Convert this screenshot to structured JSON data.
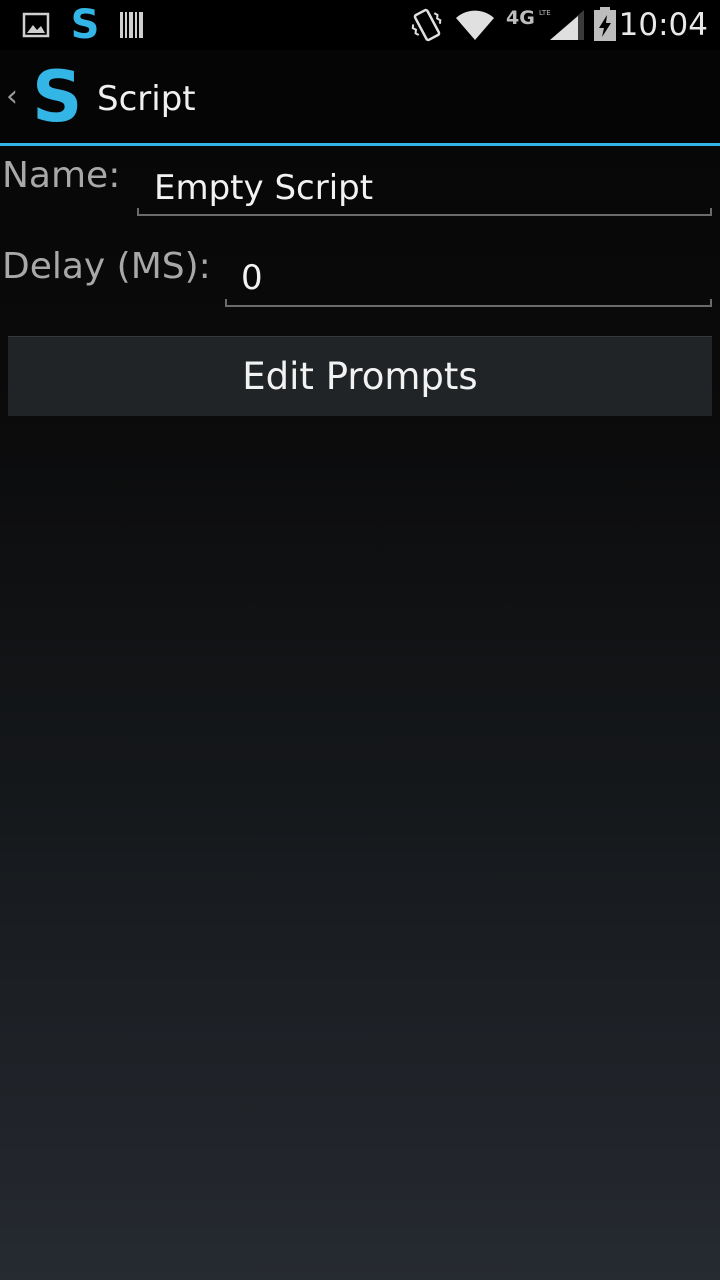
{
  "status_bar": {
    "time": "10:04",
    "network_label": "4G LTE",
    "icons": [
      "picture-notification-icon",
      "app-s-notification-icon",
      "barcode-notification-icon",
      "vibrate-icon",
      "wifi-icon",
      "network-4g-icon",
      "signal-icon",
      "battery-charging-icon"
    ]
  },
  "action_bar": {
    "up_glyph": "‹",
    "logo_letter": "S",
    "title": "Script"
  },
  "form": {
    "name_label": "Name:",
    "name_value": "Empty Script",
    "delay_label": "Delay (MS):",
    "delay_value": "0"
  },
  "buttons": {
    "edit_prompts": "Edit Prompts"
  },
  "colors": {
    "accent": "#33b5e5",
    "background_top": "#050505",
    "background_bottom": "#262a31",
    "button_bg": "#212427"
  }
}
